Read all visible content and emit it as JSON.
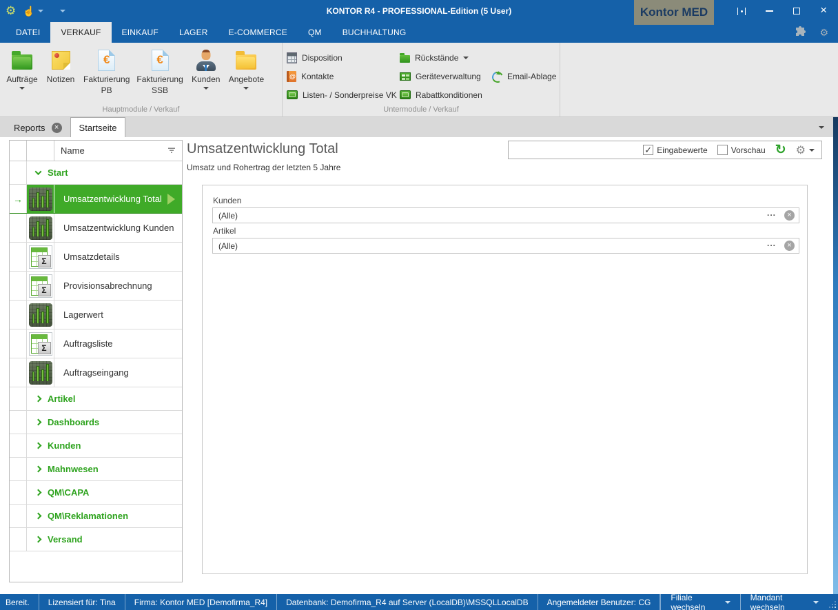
{
  "window": {
    "title": "KONTOR R4 - PROFESSIONAL-Edition (5 User)",
    "brand_badge": "Kontor MED"
  },
  "menu": {
    "tabs": [
      "DATEI",
      "VERKAUF",
      "EINKAUF",
      "LAGER",
      "E-COMMERCE",
      "QM",
      "BUCHHALTUNG"
    ],
    "active_tab": "VERKAUF"
  },
  "ribbon": {
    "hauptmodule": {
      "group_label": "Hauptmodule / Verkauf",
      "buttons": [
        {
          "label": "Aufträge",
          "has_dropdown": true,
          "icon": "green-folder-icon"
        },
        {
          "label": "Notizen",
          "has_dropdown": false,
          "icon": "sticky-note-icon"
        },
        {
          "label": "Fakturierung",
          "label2": "PB",
          "has_dropdown": false,
          "icon": "euro-document-icon"
        },
        {
          "label": "Fakturierung",
          "label2": "SSB",
          "has_dropdown": false,
          "icon": "euro-document-icon"
        },
        {
          "label": "Kunden",
          "has_dropdown": true,
          "icon": "person-icon"
        },
        {
          "label": "Angebote",
          "has_dropdown": true,
          "icon": "yellow-folder-icon"
        }
      ]
    },
    "untermodule": {
      "group_label": "Untermodule / Verkauf",
      "items": [
        {
          "label": "Disposition",
          "icon": "calculator-icon"
        },
        {
          "label": "Kontakte",
          "icon": "address-book-icon"
        },
        {
          "label": "Listen- / Sonderpreise VK",
          "icon": "price-list-icon"
        },
        {
          "label": "Rückstände",
          "icon": "small-green-folder-icon",
          "has_dropdown": true
        },
        {
          "label": "Geräteverwaltung",
          "icon": "device-board-icon"
        },
        {
          "label": "Rabattkonditionen",
          "icon": "price-list-icon"
        },
        {
          "label": "Email-Ablage",
          "icon": "email-sync-icon"
        }
      ]
    }
  },
  "document_tabs": {
    "tabs": [
      {
        "label": "Reports",
        "closable": true,
        "active": false
      },
      {
        "label": "Startseite",
        "closable": false,
        "active": true
      }
    ]
  },
  "navigator": {
    "column_header": "Name",
    "groups": [
      {
        "label": "Start",
        "expanded": true,
        "items": [
          {
            "label": "Umsatzentwicklung Total",
            "icon": "bar-chart-icon",
            "selected": true
          },
          {
            "label": "Umsatzentwicklung Kunden",
            "icon": "bar-chart-icon",
            "selected": false
          },
          {
            "label": "Umsatzdetails",
            "icon": "sum-table-icon",
            "selected": false
          },
          {
            "label": "Provisionsabrechnung",
            "icon": "sum-table-icon",
            "selected": false
          },
          {
            "label": "Lagerwert",
            "icon": "bar-chart-icon",
            "selected": false
          },
          {
            "label": "Auftragsliste",
            "icon": "sum-table-icon",
            "selected": false
          },
          {
            "label": "Auftragseingang",
            "icon": "bar-chart-icon",
            "selected": false
          }
        ]
      },
      {
        "label": "Artikel",
        "expanded": false
      },
      {
        "label": "Dashboards",
        "expanded": false
      },
      {
        "label": "Kunden",
        "expanded": false
      },
      {
        "label": "Mahnwesen",
        "expanded": false
      },
      {
        "label": "QM\\CAPA",
        "expanded": false
      },
      {
        "label": "QM\\Reklamationen",
        "expanded": false
      },
      {
        "label": "Versand",
        "expanded": false
      }
    ]
  },
  "report": {
    "title": "Umsatzentwicklung Total",
    "subtitle": "Umsatz und Rohertrag der letzten 5 Jahre",
    "toolbar": {
      "eingabewerte_label": "Eingabewerte",
      "eingabewerte_checked": true,
      "vorschau_label": "Vorschau",
      "vorschau_checked": false
    },
    "filters": [
      {
        "label": "Kunden",
        "value": "(Alle)"
      },
      {
        "label": "Artikel",
        "value": "(Alle)"
      }
    ]
  },
  "statusbar": {
    "items": [
      "Bereit.",
      "Lizensiert für: Tina",
      "Firma: Kontor MED [Demofirma_R4]",
      "Datenbank: Demofirma_R4 auf Server (LocalDB)\\MSSQLLocalDB",
      "Angemeldeter Benutzer: CG"
    ],
    "buttons": [
      {
        "label": "Filiale wechseln"
      },
      {
        "label": "Mandant wechseln"
      }
    ]
  },
  "colors": {
    "titlebar_blue": "#1561A9",
    "accent_green": "#3FAA28",
    "ribbon_gray": "#E9E9E9",
    "badge_olive": "#8B8B79"
  }
}
